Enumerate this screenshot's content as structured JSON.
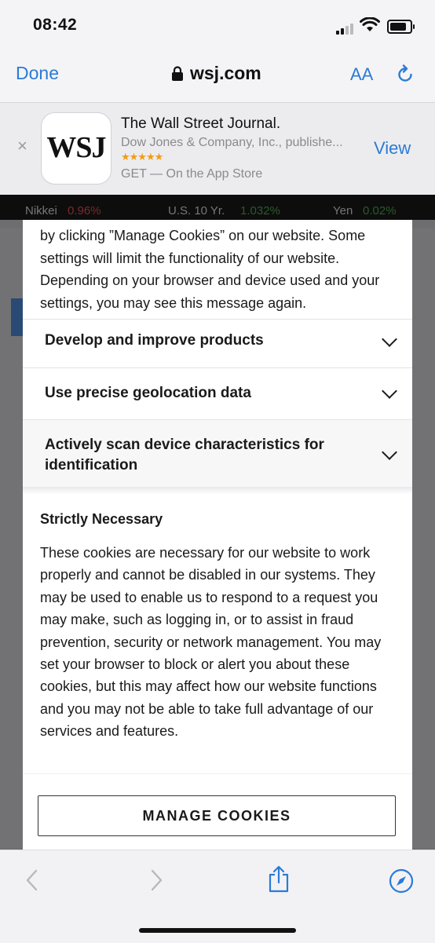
{
  "status": {
    "time": "08:42"
  },
  "safari": {
    "done": "Done",
    "url": "wsj.com",
    "text_size": "AA"
  },
  "banner": {
    "close": "×",
    "icon_text": "WSJ",
    "app_name": "The Wall Street Journal.",
    "publisher": "Dow Jones & Company, Inc., publishe...",
    "stars": "★★★★★",
    "rating": 4.5,
    "get": "GET — On the App Store",
    "view": "View"
  },
  "ticker": {
    "items": [
      {
        "name": "Nikkei",
        "value": "0.96%"
      },
      {
        "name": "U.S. 10 Yr.",
        "value": "1.032%"
      },
      {
        "name": "Yen",
        "value": "0.02%"
      }
    ]
  },
  "modal": {
    "intro": "by clicking ”Manage Cookies” on our website. Some settings will limit the functionality of our website. Depending on your browser and device used and your settings, you may see this message again.",
    "accordion": [
      {
        "label": "Develop and improve products"
      },
      {
        "label": "Use precise geolocation data"
      },
      {
        "label": "Actively scan device characteristics for identification"
      }
    ],
    "strict_title": "Strictly Necessary",
    "strict_body": "These cookies are necessary for our website to work properly and cannot be disabled in our systems. They may be used to enable us to respond to a request you may make, such as logging in, or to assist in fraud prevention, security or network management.  You may set your browser to block or alert you about these cookies, but this may affect how our website functions and you may not be able to take full advantage of our services and features.",
    "manage_button": "MANAGE COOKIES"
  },
  "colors": {
    "accent": "#2b7bd6",
    "star": "#f29b18"
  }
}
